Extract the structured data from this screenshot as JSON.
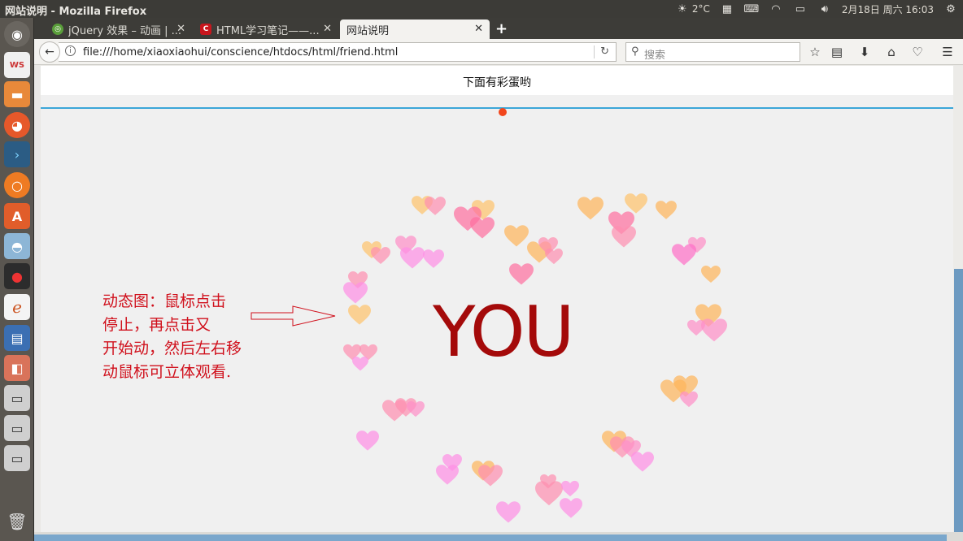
{
  "window": {
    "title": "网站说明 - Mozilla Firefox"
  },
  "tray": {
    "weather": "2°C",
    "datetime": "2月18日 周六 16:03"
  },
  "tabs": [
    {
      "label": "jQuery 效果 – 动画 | ...",
      "favicon": "green-globe",
      "active": false
    },
    {
      "label": "HTML学习笔记——...",
      "favicon": "c-red-logo",
      "active": false
    },
    {
      "label": "网站说明",
      "favicon": "",
      "active": true
    }
  ],
  "navbar": {
    "url": "file:///home/xiaoxiaohui/conscience/htdocs/html/friend.html",
    "search_placeholder": "搜索"
  },
  "page": {
    "header_text": "下面有彩蛋哟",
    "center_text": "YOU",
    "annotation_lines": [
      "动态图：鼠标点击",
      "停止，再点击又",
      "开始动，然后左右移",
      "动鼠标可立体观看."
    ],
    "colors": {
      "header_line": "#3ba6d8",
      "you_text": "#a40a0a",
      "annotation": "#d0101c",
      "dot": "#f2461c"
    }
  }
}
